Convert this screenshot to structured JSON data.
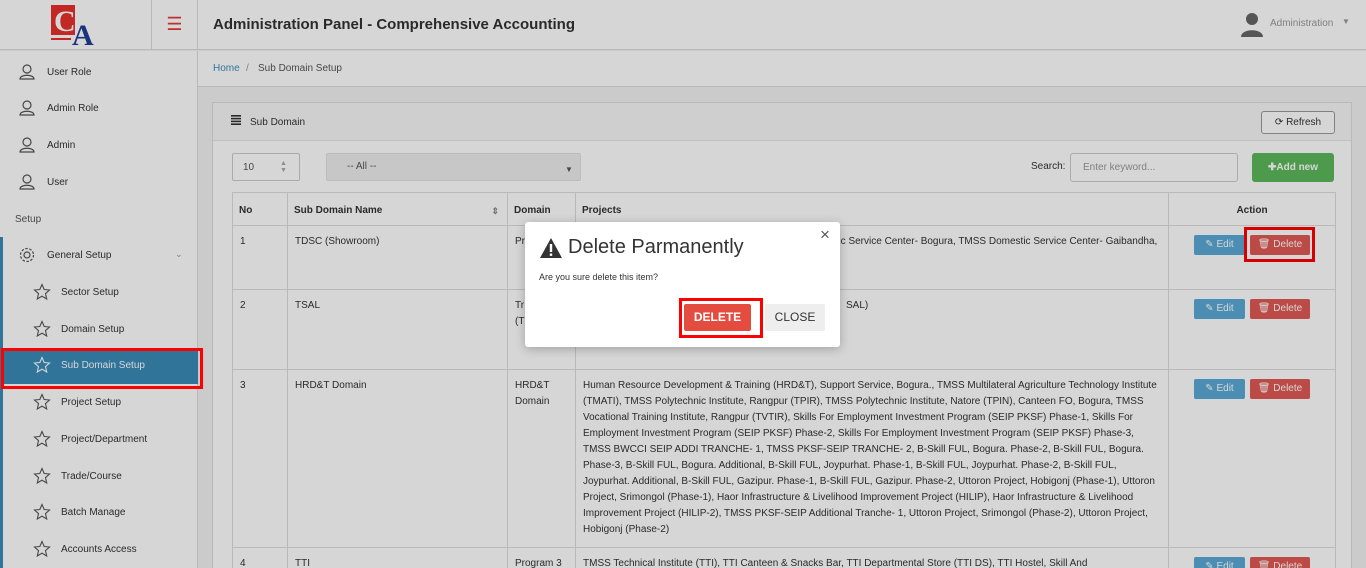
{
  "header": {
    "app_title": "Administration Panel - Comprehensive Accounting",
    "user_name": "Administration",
    "logo_letters": "CA",
    "logo_colors": {
      "red": "#e8322b",
      "blue": "#1e3f95"
    },
    "menu_icon": "hamburger-icon",
    "user_icon": "user-avatar-icon"
  },
  "sidebar": {
    "top_items": [
      {
        "label": "User Role",
        "icon": "user-icon"
      },
      {
        "label": "Admin Role",
        "icon": "user-icon"
      },
      {
        "label": "Admin",
        "icon": "user-icon"
      },
      {
        "label": "User",
        "icon": "user-icon"
      }
    ],
    "section_label": "Setup",
    "group": {
      "label": "General Setup",
      "icon": "gear-icon",
      "expanded": true
    },
    "sub_items": [
      {
        "label": "Sector Setup",
        "icon": "star-icon"
      },
      {
        "label": "Domain Setup",
        "icon": "star-icon"
      },
      {
        "label": "Sub Domain Setup",
        "icon": "star-icon",
        "active": true
      },
      {
        "label": "Project Setup",
        "icon": "star-icon"
      },
      {
        "label": "Project/Department",
        "icon": "star-icon"
      },
      {
        "label": "Trade/Course",
        "icon": "star-icon"
      },
      {
        "label": "Batch Manage",
        "icon": "star-icon"
      },
      {
        "label": "Accounts Access",
        "icon": "star-icon"
      }
    ],
    "accent_color": "#3a8bb8"
  },
  "breadcrumb": {
    "home": "Home",
    "separator": "/",
    "current": "Sub Domain Setup"
  },
  "panel": {
    "title": "Sub Domain",
    "refresh_label": "Refresh",
    "page_size": "10",
    "filter_value": "-- All --",
    "search_label": "Search:",
    "search_placeholder": "Enter keyword...",
    "add_label": "Add new",
    "add_color": "#5cb85c"
  },
  "table": {
    "columns": [
      "No",
      "Sub Domain Name",
      "Domain",
      "Projects",
      "Action"
    ],
    "edit_label": "Edit",
    "delete_label": "Delete",
    "rows": [
      {
        "no": "1",
        "name": "TDSC (Showroom)",
        "domain": "Pr",
        "projects": "TMSS Domestic Service Center- Rangpur, TMSS Domestic Service Center- Bogura, TMSS Domestic Service Center- Gaibandha, TMSS Domestic Service Center- Noongola"
      },
      {
        "no": "2",
        "name": "TSAL",
        "domain": "Tr Bu Se (TBS)",
        "projects": "SAL)"
      },
      {
        "no": "3",
        "name": "HRD&T Domain",
        "domain": "HRD&T Domain",
        "projects": "Human Resource Development & Training (HRD&T), Support Service, Bogura., TMSS Multilateral Agriculture Technology Institute (TMATI), TMSS Polytechnic Institute, Rangpur (TPIR), TMSS Polytechnic Institute, Natore (TPIN), Canteen FO, Bogura, TMSS Vocational Training Institute, Rangpur (TVTIR), Skills For Employment Investment Program (SEIP PKSF) Phase-1, Skills For Employment Investment Program (SEIP PKSF) Phase-2, Skills For Employment Investment Program (SEIP PKSF) Phase-3, TMSS BWCCI SEIP ADDI TRANCHE- 1, TMSS PKSF-SEIP TRANCHE- 2, B-Skill FUL, Bogura. Phase-2, B-Skill FUL, Bogura. Phase-3, B-Skill FUL, Bogura. Additional, B-Skill FUL, Joypurhat. Phase-1, B-Skill FUL, Joypurhat. Phase-2, B-Skill FUL, Joypurhat. Additional, B-Skill FUL, Gazipur. Phase-1, B-Skill FUL, Gazipur. Phase-2, Uttoron Project, Hobigonj (Phase-1), Uttoron Project, Srimongol (Phase-1), Haor Infrastructure & Livelihood Improvement Project (HILIP), Haor Infrastructure & Livelihood Improvement Project (HILIP-2), TMSS PKSF-SEIP Additional Tranche- 1, Uttoron Project, Srimongol (Phase-2), Uttoron Project, Hobigonj (Phase-2)"
      },
      {
        "no": "4",
        "name": "TTI",
        "domain": "Program 3",
        "projects": "TMSS Technical Institute (TTI), TTI Canteen & Snacks Bar, TTI Departmental Store (TTI DS), TTI Hostel, Skill And"
      }
    ]
  },
  "modal": {
    "title": "Delete Parmanently",
    "message": "Are you sure delete this item?",
    "confirm_label": "DELETE",
    "close_label": "CLOSE",
    "icon": "warning-icon",
    "confirm_color": "#e34c3f"
  },
  "highlight_color": "#ff0000"
}
